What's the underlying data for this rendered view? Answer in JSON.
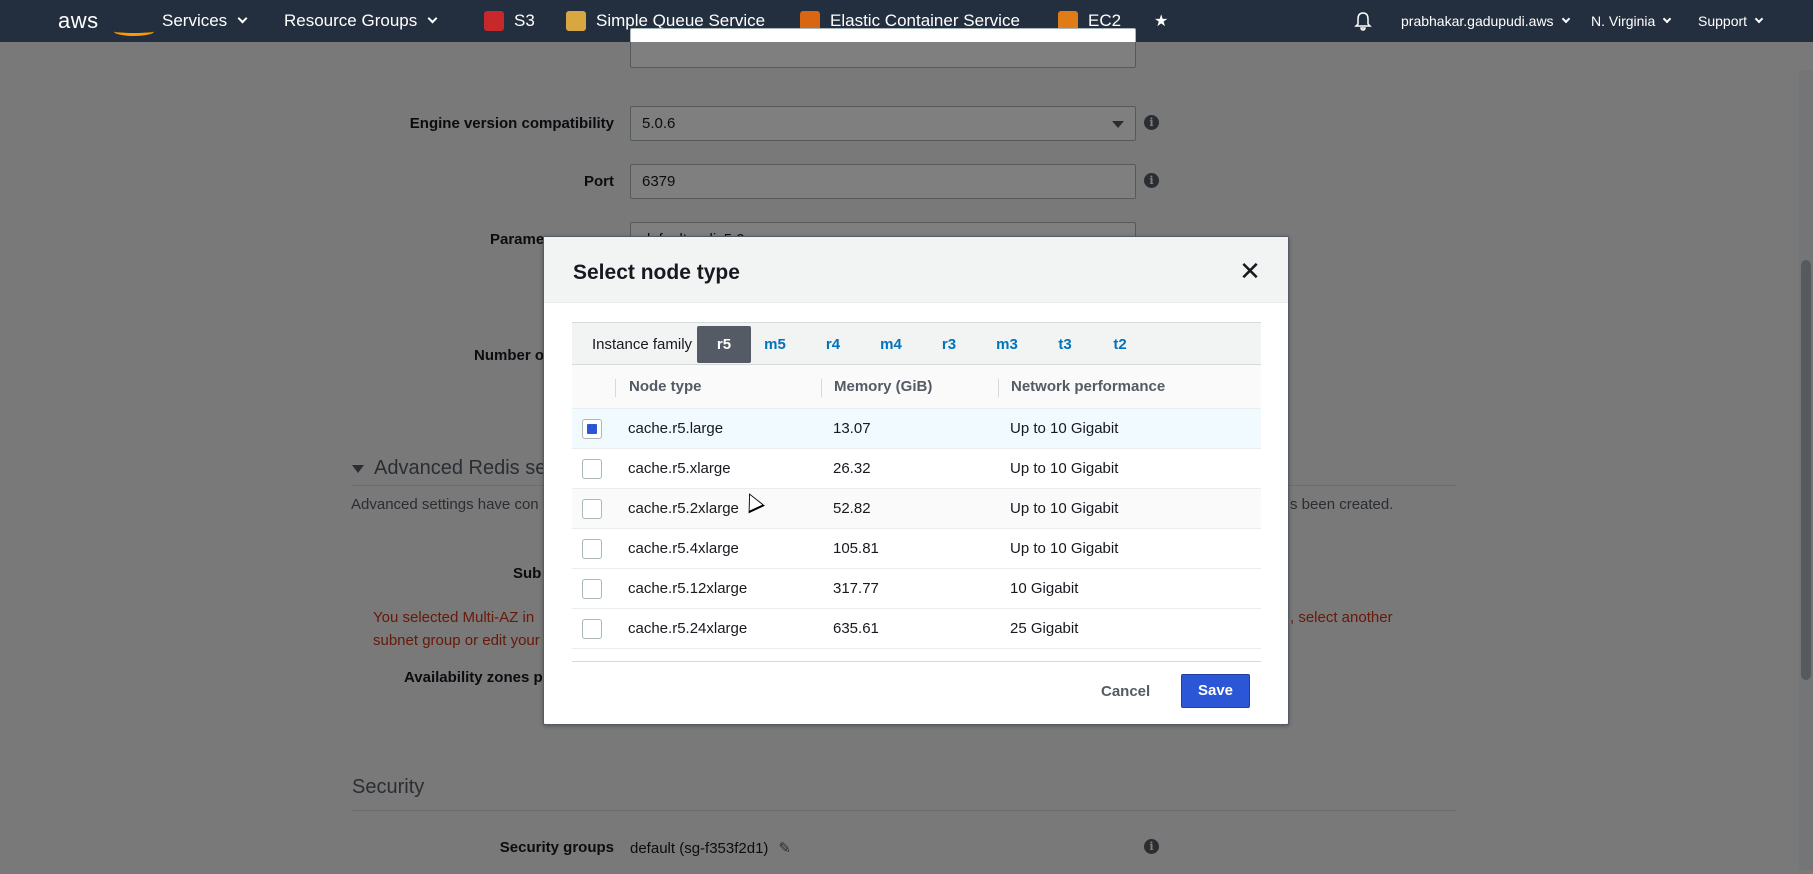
{
  "nav": {
    "logo": "aws",
    "services": "Services",
    "resource_groups": "Resource Groups",
    "shortcuts": [
      {
        "label": "S3",
        "icon": "s3-icon",
        "color": "#c7282a"
      },
      {
        "label": "Simple Queue Service",
        "icon": "sqs-icon",
        "color": "#d9a741"
      },
      {
        "label": "Elastic Container Service",
        "icon": "ecs-icon",
        "color": "#d86613"
      },
      {
        "label": "EC2",
        "icon": "ec2-icon",
        "color": "#e07b15"
      }
    ],
    "pin_icon": "pin-icon",
    "bell_icon": "bell-icon",
    "account": "prabhakar.gadupudi.aws",
    "region": "N. Virginia",
    "support": "Support"
  },
  "form": {
    "engine_label": "Engine version compatibility",
    "engine_value": "5.0.6",
    "port_label": "Port",
    "port_value": "6379",
    "param_label_partial": "Parame",
    "param_value_partial": "default.redis5.0",
    "number_label_partial": "Number o",
    "advanced_title": "Advanced Redis se",
    "advanced_desc_left": "Advanced settings have con",
    "advanced_desc_right": "s been created.",
    "subnet_label_partial": "Sub",
    "error_line1_left": "You selected Multi-AZ in",
    "error_line1_right": ", select another",
    "error_line2": "subnet group or edit your",
    "az_label_partial": "Availability zones p",
    "security_title": "Security",
    "security_groups_label": "Security groups",
    "security_groups_value": "default (sg-f353f2d1)"
  },
  "modal": {
    "title": "Select node type",
    "family_label": "Instance family",
    "families": [
      "r5",
      "m5",
      "r4",
      "m4",
      "r3",
      "m3",
      "t3",
      "t2"
    ],
    "active_family": "r5",
    "columns": [
      "Node type",
      "Memory (GiB)",
      "Network performance"
    ],
    "rows": [
      {
        "node": "cache.r5.large",
        "memory": "13.07",
        "network": "Up to 10 Gigabit",
        "checked": true
      },
      {
        "node": "cache.r5.xlarge",
        "memory": "26.32",
        "network": "Up to 10 Gigabit",
        "checked": false
      },
      {
        "node": "cache.r5.2xlarge",
        "memory": "52.82",
        "network": "Up to 10 Gigabit",
        "checked": false
      },
      {
        "node": "cache.r5.4xlarge",
        "memory": "105.81",
        "network": "Up to 10 Gigabit",
        "checked": false
      },
      {
        "node": "cache.r5.12xlarge",
        "memory": "317.77",
        "network": "10 Gigabit",
        "checked": false
      },
      {
        "node": "cache.r5.24xlarge",
        "memory": "635.61",
        "network": "25 Gigabit",
        "checked": false
      }
    ],
    "cancel": "Cancel",
    "save": "Save"
  },
  "colors": {
    "nav_bg": "#232f3e",
    "accent_orange": "#ff9900",
    "primary_button": "#2b57d7",
    "link": "#0073bb",
    "error": "#d13212"
  }
}
